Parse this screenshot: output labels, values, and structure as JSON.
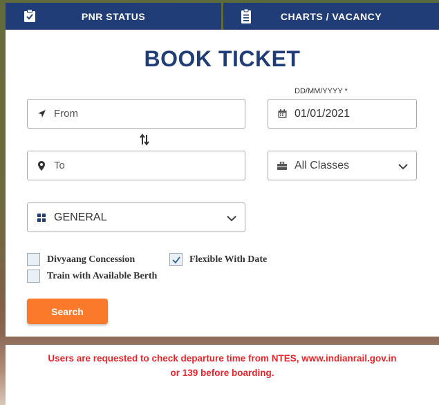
{
  "top_tabs": [
    {
      "label": "PNR STATUS",
      "icon": "clipboard-check-icon"
    },
    {
      "label": "CHARTS / VACANCY",
      "icon": "document-list-icon"
    }
  ],
  "form": {
    "title": "BOOK TICKET",
    "from_placeholder": "From",
    "to_placeholder": "To",
    "date_label": "DD/MM/YYYY *",
    "date_value": "01/01/2021",
    "class_value": "All Classes",
    "quota_value": "GENERAL",
    "checkboxes": [
      {
        "label": "Divyaang Concession",
        "checked": false
      },
      {
        "label": "Flexible With Date",
        "checked": true
      },
      {
        "label": "Train with Available Berth",
        "checked": false
      }
    ],
    "search_label": "Search"
  },
  "notice": {
    "line1": "Users are requested to check departure time from NTES, www.indianrail.gov.in",
    "line2": "or 139 before boarding."
  },
  "colors": {
    "primary": "#213d77",
    "accent": "#fb792b",
    "notice": "#e8242b"
  }
}
